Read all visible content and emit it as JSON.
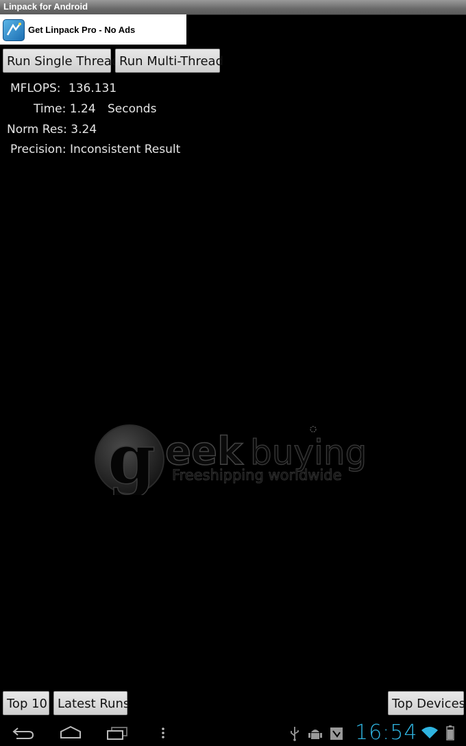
{
  "app": {
    "title": "Linpack for Android"
  },
  "ad": {
    "text": "Get Linpack Pro - No Ads",
    "icon": "linpack-pro-icon"
  },
  "actions": {
    "single_thread": "Run Single Thread",
    "multi_thread": "Run Multi-Thread"
  },
  "results": {
    "mflops_label": "MFLOPS:",
    "mflops_value": "136.131",
    "time_label": "Time:",
    "time_value": "1.24",
    "time_unit": "Seconds",
    "normres_label": "Norm Res:",
    "normres_value": "3.24",
    "precision_label": "Precision:",
    "precision_value": "Inconsistent Result"
  },
  "watermark": {
    "brand_g": "g",
    "brand_eek": "eek",
    "brand_buying": "buying",
    "tagline": "Freeshipping worldwide"
  },
  "bottom": {
    "top10": "Top 10",
    "latest_runs": "Latest Runs",
    "top_devices": "Top Devices"
  },
  "status": {
    "time": "16:54",
    "accent": "#2fb4e0"
  }
}
